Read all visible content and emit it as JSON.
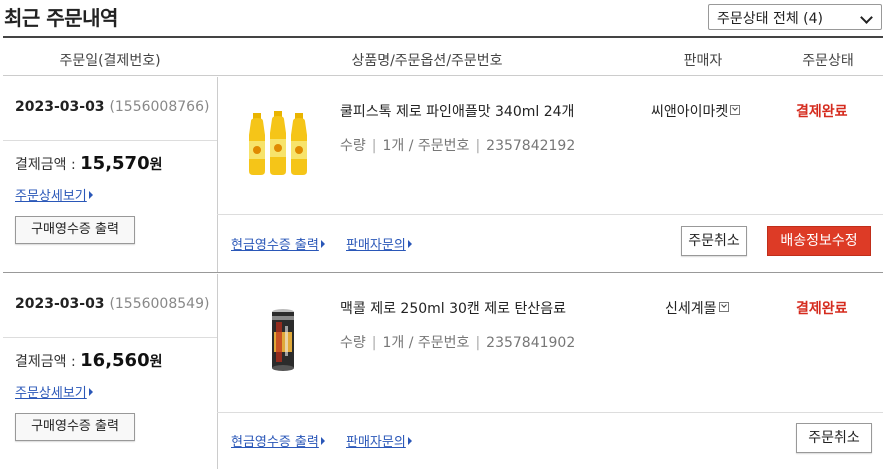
{
  "page": {
    "title": "최근 주문내역"
  },
  "filter": {
    "selected": "주문상태 전체 (4)"
  },
  "columns": {
    "order_date": "주문일(결제번호)",
    "product": "상품명/주문옵션/주문번호",
    "seller": "판매자",
    "status": "주문상태"
  },
  "orders": [
    {
      "date": "2023-03-03",
      "payment_no": "(1556008766)",
      "amount_label": "결제금액 :",
      "amount": "15,570",
      "currency": "원",
      "detail_link": "주문상세보기",
      "receipt_button": "구매영수증 출력",
      "product_name": "쿨피스톡 제로 파인애플맛 340ml 24개",
      "qty_label": "수량",
      "qty": "1개 /",
      "order_no_label": "주문번호",
      "order_no": "2357842192",
      "seller": "씨앤아이마켓",
      "status": "결제완료",
      "cash_receipt_link": "현금영수증 출력",
      "inquiry_link": "판매자문의",
      "cancel_button": "주문취소",
      "shipping_button": "배송정보수정",
      "thumb_icon": "pineapple-drink-bottles-icon"
    },
    {
      "date": "2023-03-03",
      "payment_no": "(1556008549)",
      "amount_label": "결제금액 :",
      "amount": "16,560",
      "currency": "원",
      "detail_link": "주문상세보기",
      "receipt_button": "구매영수증 출력",
      "product_name": "맥콜 제로 250ml 30캔 제로 탄산음료",
      "qty_label": "수량",
      "qty": "1개 /",
      "order_no_label": "주문번호",
      "order_no": "2357841902",
      "seller": "신세계몰",
      "status": "결제완료",
      "cash_receipt_link": "현금영수증 출력",
      "inquiry_link": "판매자문의",
      "cancel_button": "주문취소",
      "thumb_icon": "soda-can-icon"
    }
  ],
  "colors": {
    "status_red": "#d52b1e",
    "link_blue": "#2a57b8",
    "shipping_button": "#dd3b26"
  }
}
